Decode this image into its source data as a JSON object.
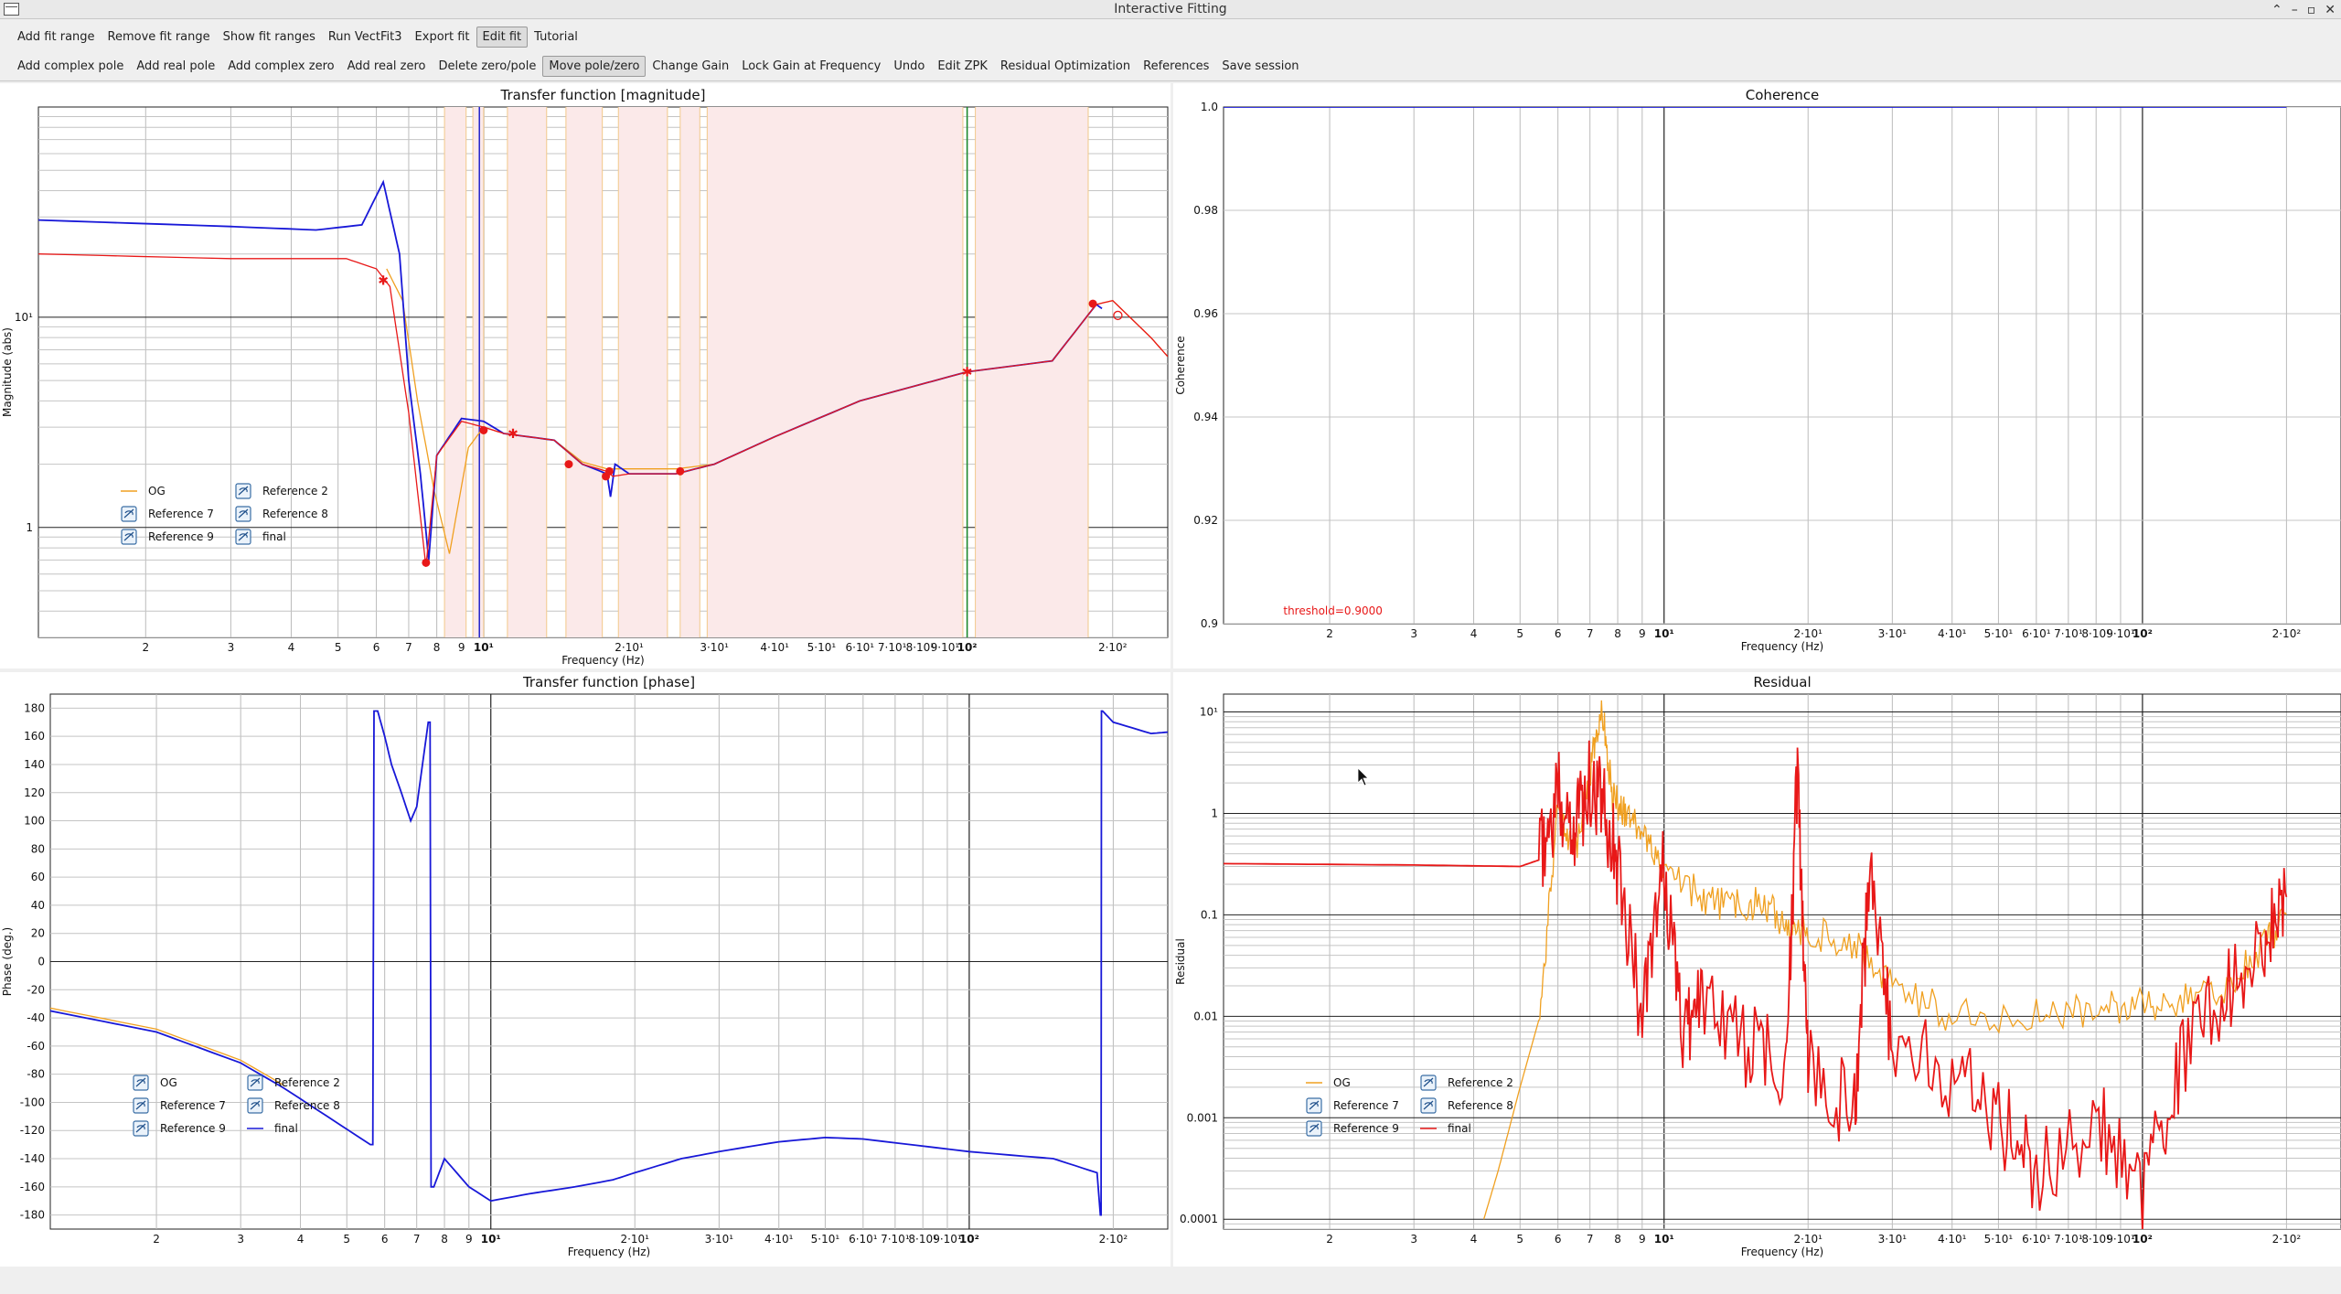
{
  "window": {
    "title": "Interactive Fitting",
    "controls": [
      "⌃",
      "–",
      "▫",
      "✕"
    ]
  },
  "toolbar1": [
    "Add fit range",
    "Remove fit range",
    "Show fit ranges",
    "Run VectFit3",
    "Export fit",
    "Edit fit",
    "Tutorial"
  ],
  "toolbar1_active": "Edit fit",
  "toolbar2": [
    "Add complex pole",
    "Add real pole",
    "Add complex zero",
    "Add real zero",
    "Delete zero/pole",
    "Move pole/zero",
    "Change Gain",
    "Lock Gain at Frequency",
    "Undo",
    "Edit ZPK",
    "Residual Optimization",
    "References",
    "Save session"
  ],
  "toolbar2_active": "Move pole/zero",
  "colors": {
    "og": "#f0a020",
    "fit": "#e81818",
    "data": "#1818d8",
    "region": "#fbe9e9",
    "region_edge": "#f2c98a"
  },
  "plots": {
    "magnitude": {
      "title": "Transfer function [magnitude]",
      "xlabel": "Frequency (Hz)",
      "ylabel": "Magnitude (abs)",
      "yscale": "log",
      "ylim": [
        0.3,
        100
      ],
      "yticks": [
        {
          "v": 1,
          "t": "1"
        },
        {
          "v": 10,
          "t": "10¹"
        }
      ],
      "legend": [
        {
          "name": "OG",
          "kind": "line",
          "color": "#f0a020"
        },
        {
          "name": "Reference 2",
          "kind": "box"
        },
        {
          "name": "Reference 7",
          "kind": "box"
        },
        {
          "name": "Reference 8",
          "kind": "box"
        },
        {
          "name": "Reference 9",
          "kind": "box"
        },
        {
          "name": "final",
          "kind": "box"
        }
      ]
    },
    "coherence": {
      "title": "Coherence",
      "xlabel": "Frequency (Hz)",
      "ylabel": "Coherence",
      "yscale": "linear",
      "ylim": [
        0.9,
        1.0
      ],
      "yticks": [
        {
          "v": 0.9,
          "t": "0.9"
        },
        {
          "v": 0.92,
          "t": "0.92"
        },
        {
          "v": 0.94,
          "t": "0.94"
        },
        {
          "v": 0.96,
          "t": "0.96"
        },
        {
          "v": 0.98,
          "t": "0.98"
        },
        {
          "v": 1.0,
          "t": "1.0"
        }
      ],
      "threshold_label": "threshold=0.9000"
    },
    "phase": {
      "title": "Transfer function [phase]",
      "xlabel": "Frequency (Hz)",
      "ylabel": "Phase (deg.)",
      "yscale": "linear",
      "ylim": [
        -190,
        190
      ],
      "yticks": [
        {
          "v": 180,
          "t": "180"
        },
        {
          "v": 160,
          "t": "160"
        },
        {
          "v": 140,
          "t": "140"
        },
        {
          "v": 120,
          "t": "120"
        },
        {
          "v": 100,
          "t": "100"
        },
        {
          "v": 80,
          "t": "80"
        },
        {
          "v": 60,
          "t": "60"
        },
        {
          "v": 40,
          "t": "40"
        },
        {
          "v": 20,
          "t": "20"
        },
        {
          "v": 0,
          "t": "0"
        },
        {
          "v": -20,
          "t": "-20"
        },
        {
          "v": -40,
          "t": "-40"
        },
        {
          "v": -60,
          "t": "-60"
        },
        {
          "v": -80,
          "t": "-80"
        },
        {
          "v": -100,
          "t": "-100"
        },
        {
          "v": -120,
          "t": "-120"
        },
        {
          "v": -140,
          "t": "-140"
        },
        {
          "v": -160,
          "t": "-160"
        },
        {
          "v": -180,
          "t": "-180"
        }
      ],
      "legend": [
        {
          "name": "OG",
          "kind": "box"
        },
        {
          "name": "Reference 2",
          "kind": "box"
        },
        {
          "name": "Reference 7",
          "kind": "box"
        },
        {
          "name": "Reference 8",
          "kind": "box"
        },
        {
          "name": "Reference 9",
          "kind": "box"
        },
        {
          "name": "final",
          "kind": "line",
          "color": "#1818d8"
        }
      ]
    },
    "residual": {
      "title": "Residual",
      "xlabel": "Frequency (Hz)",
      "ylabel": "Residual",
      "yscale": "log",
      "ylim": [
        8e-05,
        15
      ],
      "yticks": [
        {
          "v": 0.0001,
          "t": "0.0001"
        },
        {
          "v": 0.001,
          "t": "0.001"
        },
        {
          "v": 0.01,
          "t": "0.01"
        },
        {
          "v": 0.1,
          "t": "0.1"
        },
        {
          "v": 1,
          "t": "1"
        },
        {
          "v": 10,
          "t": "10¹"
        }
      ],
      "legend": [
        {
          "name": "OG",
          "kind": "line",
          "color": "#f0a020"
        },
        {
          "name": "Reference 2",
          "kind": "box"
        },
        {
          "name": "Reference 7",
          "kind": "box"
        },
        {
          "name": "Reference 8",
          "kind": "box"
        },
        {
          "name": "Reference 9",
          "kind": "box"
        },
        {
          "name": "final",
          "kind": "line",
          "color": "#e81818"
        }
      ]
    }
  },
  "xticks": [
    {
      "v": 2,
      "t": "2"
    },
    {
      "v": 3,
      "t": "3"
    },
    {
      "v": 4,
      "t": "4"
    },
    {
      "v": 5,
      "t": "5"
    },
    {
      "v": 6,
      "t": "6"
    },
    {
      "v": 7,
      "t": "7"
    },
    {
      "v": 8,
      "t": "8"
    },
    {
      "v": 9,
      "t": "9"
    },
    {
      "v": 10,
      "t": "10¹"
    },
    {
      "v": 20,
      "t": "2·10¹"
    },
    {
      "v": 30,
      "t": "3·10¹"
    },
    {
      "v": 40,
      "t": "4·10¹"
    },
    {
      "v": 50,
      "t": "5·10¹"
    },
    {
      "v": 60,
      "t": "6·10¹"
    },
    {
      "v": 70,
      "t": "7·10¹"
    },
    {
      "v": 80,
      "t": "8·10¹"
    },
    {
      "v": 90,
      "t": "9·10¹"
    },
    {
      "v": 100,
      "t": "10²"
    },
    {
      "v": 200,
      "t": "2·10²"
    }
  ],
  "chart_data": [
    {
      "type": "line",
      "title": "Transfer function [magnitude]",
      "xlabel": "Frequency (Hz)",
      "ylabel": "Magnitude (abs)",
      "xscale": "log",
      "yscale": "log",
      "xlim": [
        1.2,
        260
      ],
      "ylim": [
        0.3,
        100
      ],
      "series": [
        {
          "name": "final",
          "x": [
            1.2,
            3,
            4.5,
            5.6,
            6.2,
            6.7,
            7.0,
            7.4,
            7.7,
            8.0,
            9,
            10,
            11,
            14,
            16,
            18,
            18.3,
            18.7,
            20,
            25,
            30,
            40,
            60,
            100,
            150,
            185,
            190
          ],
          "y": [
            29,
            27,
            26,
            27.5,
            44,
            20,
            5.0,
            1.8,
            0.7,
            2.2,
            3.3,
            3.2,
            2.8,
            2.6,
            2.0,
            1.8,
            1.4,
            2.0,
            1.8,
            1.8,
            2.0,
            2.7,
            4.0,
            5.5,
            6.2,
            11.5,
            11
          ]
        },
        {
          "name": "fit",
          "x": [
            1.2,
            3,
            5.2,
            6.0,
            6.4,
            7.0,
            7.6,
            8.0,
            9,
            10,
            11,
            14,
            16,
            18,
            18.5,
            20,
            25,
            30,
            40,
            60,
            100,
            150,
            185,
            200,
            240,
            260
          ],
          "y": [
            20,
            19,
            19,
            17,
            14,
            3.5,
            0.65,
            2.2,
            3.2,
            3.0,
            2.8,
            2.6,
            2.0,
            1.85,
            1.75,
            1.8,
            1.8,
            2.0,
            2.7,
            4.0,
            5.5,
            6.2,
            11.5,
            12,
            8,
            6.5
          ]
        },
        {
          "name": "OG",
          "x": [
            6.3,
            6.8,
            7.3,
            7.9,
            8.5,
            9.3,
            10,
            11,
            14,
            16,
            18,
            20,
            25,
            30,
            40,
            60,
            100,
            150,
            185,
            200,
            240,
            260
          ],
          "y": [
            17,
            12,
            4.0,
            1.5,
            0.75,
            2.4,
            3.0,
            2.8,
            2.6,
            2.05,
            1.9,
            1.9,
            1.9,
            2.0,
            2.7,
            4.0,
            5.5,
            6.2,
            11.5,
            12,
            8,
            6.5
          ]
        }
      ]
    },
    {
      "type": "line",
      "title": "Coherence",
      "xlabel": "Frequency (Hz)",
      "ylabel": "Coherence",
      "xscale": "log",
      "xlim": [
        1.2,
        260
      ],
      "ylim": [
        0.9,
        1.0
      ],
      "series": [
        {
          "name": "coherence",
          "x": [
            1.2,
            200
          ],
          "y": [
            1.0,
            1.0
          ]
        }
      ]
    },
    {
      "type": "line",
      "title": "Transfer function [phase]",
      "xlabel": "Frequency (Hz)",
      "ylabel": "Phase (deg.)",
      "xscale": "log",
      "xlim": [
        1.2,
        260
      ],
      "ylim": [
        -190,
        190
      ],
      "series": [
        {
          "name": "final",
          "x": [
            1.2,
            2,
            3,
            3.7,
            5.6,
            5.8,
            6.0,
            6.2,
            6.5,
            6.8,
            7.0,
            7.4,
            7.6,
            8,
            9,
            10,
            12,
            15,
            18,
            20,
            25,
            30,
            40,
            50,
            60,
            100,
            150,
            185,
            188,
            190,
            200,
            240,
            260
          ],
          "y": [
            -35,
            -50,
            -72,
            -90,
            -130,
            178,
            160,
            140,
            120,
            100,
            110,
            170,
            -160,
            -140,
            -160,
            -170,
            -165,
            -160,
            -155,
            -150,
            -140,
            -135,
            -128,
            -125,
            -126,
            -135,
            -140,
            -150,
            -180,
            178,
            170,
            162,
            163
          ]
        },
        {
          "name": "OG",
          "x": [
            1.2,
            2,
            3,
            3.7
          ],
          "y": [
            -33,
            -48,
            -70,
            -88
          ]
        }
      ]
    },
    {
      "type": "line",
      "title": "Residual",
      "xlabel": "Frequency (Hz)",
      "ylabel": "Residual",
      "xscale": "log",
      "yscale": "log",
      "xlim": [
        1.2,
        260
      ],
      "ylim": [
        8e-05,
        15
      ],
      "series": [
        {
          "name": "OG",
          "x": [
            4.2,
            4.5,
            5,
            5.5,
            6,
            6.5,
            7,
            7.4,
            7.8,
            8.3,
            9,
            10,
            12,
            14,
            16,
            18,
            20,
            25,
            30,
            40,
            60,
            80,
            100,
            120,
            150,
            180,
            200
          ],
          "y": [
            0.0001,
            0.0003,
            0.002,
            0.01,
            1.3,
            0.4,
            2.5,
            12,
            1.5,
            1.0,
            0.6,
            0.3,
            0.15,
            0.12,
            0.13,
            0.08,
            0.07,
            0.05,
            0.02,
            0.01,
            0.01,
            0.012,
            0.013,
            0.015,
            0.02,
            0.05,
            0.1
          ]
        },
        {
          "name": "final",
          "x": [
            1.2,
            3,
            5,
            5.5,
            6,
            6.5,
            7,
            7.5,
            8,
            9,
            10,
            11,
            12,
            15,
            18,
            19,
            20,
            25,
            27,
            30,
            40,
            50,
            60,
            80,
            100,
            120,
            150,
            180,
            200
          ],
          "y": [
            0.32,
            0.31,
            0.3,
            0.35,
            1.5,
            0.8,
            2.0,
            1.2,
            0.3,
            0.01,
            0.3,
            0.005,
            0.02,
            0.005,
            0.003,
            2.5,
            0.004,
            0.001,
            0.4,
            0.005,
            0.0025,
            0.001,
            0.0003,
            0.001,
            0.0002,
            0.003,
            0.02,
            0.05,
            0.15
          ]
        }
      ]
    }
  ]
}
